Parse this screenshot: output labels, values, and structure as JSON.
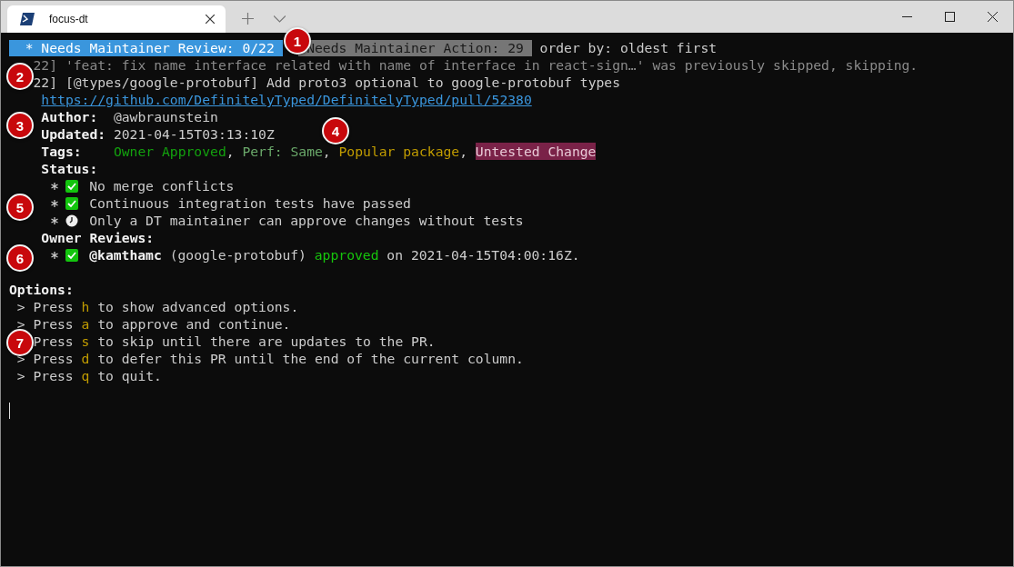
{
  "window": {
    "tab": {
      "title": "focus-dt",
      "selected": true
    }
  },
  "terminal": {
    "header": {
      "columns": [
        {
          "label": "* Needs Maintainer Review: 0/22",
          "selected": true
        },
        {
          "label": "Needs Maintainer Action: 29",
          "selected": false
        }
      ],
      "order": "order by: oldest first"
    },
    "skipped_line": "22] 'feat: fix name interface related with name of interface in react-sign…' was previously skipped, skipping.",
    "pr": {
      "index": "22]",
      "title": "[@types/google-protobuf] Add proto3 optional to google-protobuf types",
      "url": "https://github.com/DefinitelyTyped/DefinitelyTyped/pull/52380",
      "fields": [
        {
          "label": "Author:",
          "value": "@awbraunstein"
        },
        {
          "label": "Updated:",
          "value": "2021-04-15T03:13:10Z"
        }
      ],
      "tags_label": "Tags:",
      "tags": [
        {
          "label": "Owner Approved",
          "color": "#13a10e",
          "highlighted": false,
          "separator": ","
        },
        {
          "label": "Perf: Same",
          "color": "#6aa86a",
          "highlighted": false,
          "separator": ","
        },
        {
          "label": "Popular package",
          "color": "#c19c00",
          "highlighted": false,
          "separator": ","
        },
        {
          "label": "Untested Change",
          "color": "#7a2248",
          "highlighted": true
        }
      ],
      "status_label": "Status:",
      "status": [
        {
          "kind": "check",
          "text": "No merge conflicts"
        },
        {
          "kind": "check",
          "text": "Continuous integration tests have passed"
        },
        {
          "kind": "clock",
          "text": "Only a DT maintainer can approve changes without tests"
        }
      ],
      "reviews_label": "Owner Reviews:",
      "reviews": [
        {
          "user": "@kamthamc",
          "package": "(google-protobuf)",
          "verdict": "approved",
          "date": "on 2021-04-15T04:00:16Z."
        }
      ]
    },
    "options": {
      "title": "Options:",
      "items": [
        {
          "prompt": ">",
          "verb": "Press",
          "key": "h",
          "text": "to show advanced options."
        },
        {
          "prompt": ">",
          "verb": "Press",
          "key": "a",
          "text": "to approve and continue."
        },
        {
          "verb": "Press",
          "key": "s",
          "text": "to skip until there are updates to the PR."
        },
        {
          "prompt": ">",
          "verb": "Press",
          "key": "d",
          "text": "to defer this PR until the end of the current column."
        },
        {
          "prompt": ">",
          "verb": "Press",
          "key": "q",
          "text": "to quit."
        }
      ]
    }
  },
  "callouts": [
    "1",
    "2",
    "3",
    "4",
    "5",
    "6",
    "7"
  ]
}
